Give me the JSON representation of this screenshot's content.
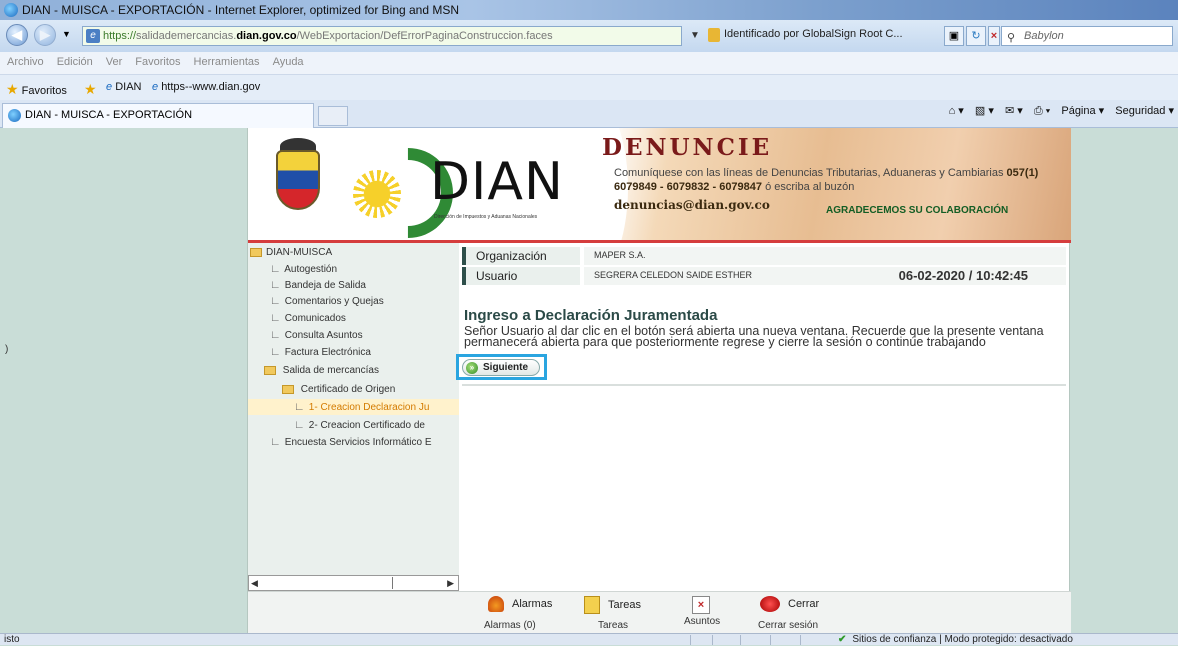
{
  "browser": {
    "window_title": "DIAN - MUISCA - EXPORTACIÓN - Internet Explorer, optimized for Bing and MSN",
    "url_scheme": "https://",
    "url_pre": "salidademercancias.",
    "url_host": "dian.gov.co",
    "url_path": "/WebExportacion/DefErrorPaginaConstruccion.faces",
    "certificate": "Identificado por GlobalSign Root C...",
    "search_placeholder": "Babylon",
    "menu": [
      "Archivo",
      "Edición",
      "Ver",
      "Favoritos",
      "Herramientas",
      "Ayuda"
    ],
    "favorites_label": "Favoritos",
    "fav_items": [
      "DIAN",
      "https--www.dian.gov"
    ],
    "tab_title": "DIAN - MUISCA - EXPORTACIÓN",
    "cmd_page": "Página ▾",
    "cmd_security": "Seguridad ▾",
    "status_left": "isto",
    "status_right": "Sitios de confianza | Modo protegido: desactivado"
  },
  "banner": {
    "logo_text": "DIAN",
    "logo_subtitle": "Dirección de Impuestos y Aduanas Nacionales",
    "headline": "DENUNCIE",
    "text_pre": "Comuníquese con las líneas de Denuncias Tributarias, Aduaneras y Cambiarias ",
    "phones": "057(1) 6079849 - 6079832 - 6079847",
    "text_post": " ó escriba al buzón",
    "email": "denuncias@dian.gov.co",
    "thanks": "AGRADECEMOS SU COLABORACIÓN"
  },
  "sidebar": {
    "root": "DIAN-MUISCA",
    "items": [
      "Autogestión",
      "Bandeja de Salida",
      "Comentarios y Quejas",
      "Comunicados",
      "Consulta Asuntos",
      "Factura Electrónica",
      "Salida de mercancías",
      "Certificado de Origen",
      "1- Creacion Declaracion Ju",
      "2- Creacion Certificado de",
      "Encuesta Servicios Informático E"
    ]
  },
  "main": {
    "org_label": "Organización",
    "org_value": "MAPER S.A.",
    "user_label": "Usuario",
    "user_value": "SEGRERA CELEDON SAIDE ESTHER",
    "datetime": "06-02-2020 / 10:42:45",
    "heading": "Ingreso a Declaración Juramentada",
    "description": "Señor Usuario al dar clic en el botón será abierta una nueva ventana. Recuerde que la presente ventana permanecerá abierta para que posteriormente regrese y cierre la sesión o continúe trabajando",
    "next_button": "Siguiente"
  },
  "footer": {
    "alarms": "Alarmas",
    "alarms_sub": "Alarmas (0)",
    "tasks": "Tareas",
    "tasks_sub": "Tareas",
    "subjects": "Asuntos",
    "close": "Cerrar",
    "close_sub": "Cerrar sesión"
  }
}
